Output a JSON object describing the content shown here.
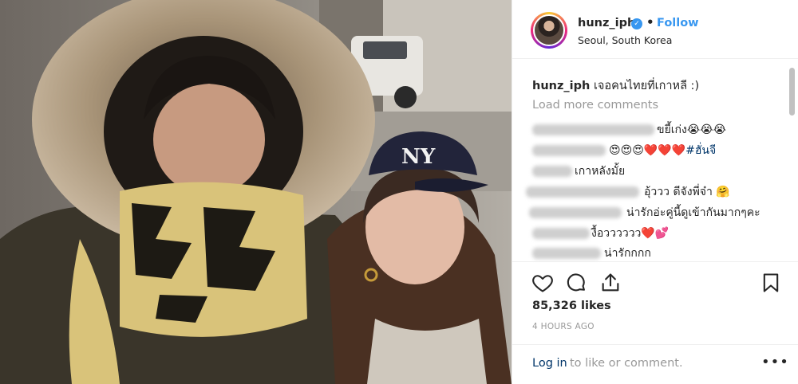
{
  "post": {
    "username": "hunz_iph",
    "verified_glyph": "✓",
    "separator": "•",
    "follow_label": "Follow",
    "location": "Seoul, South Korea",
    "caption_user": "hunz_iph",
    "caption_text": " เจอคนไทยที่เกาหลี :)",
    "load_more": "Load more comments",
    "likes": "85,326 likes",
    "time": "4 HOURS AGO",
    "login_link": "Log in",
    "login_rest": " to like or comment.",
    "more": "•••"
  },
  "comments": [
    {
      "text": "ขยี้เก่ง",
      "emoji": "😭😭😭"
    },
    {
      "text": "",
      "emoji": "😍😍😍",
      "hearts": "❤️❤️❤️",
      "tag": "#ฮั่นจี"
    },
    {
      "text": "เกาหลังมั้ย"
    },
    {
      "text": "อุ้ววว ดีจังพี่จ๋า ",
      "emoji": "🤗"
    },
    {
      "text": "น่ารักอ่ะคู่นี้ดูเข้ากันมากๆคะ"
    },
    {
      "text": "งื้อวววววว",
      "hearts": "❤️💕"
    },
    {
      "text": "น่ารักกกก"
    }
  ],
  "icons": [
    "heart-outline",
    "comment-bubble",
    "share-arrow",
    "bookmark"
  ],
  "colors": {
    "accent": "#3897f0",
    "link": "#003569",
    "muted": "#999999",
    "border": "#efefef"
  }
}
